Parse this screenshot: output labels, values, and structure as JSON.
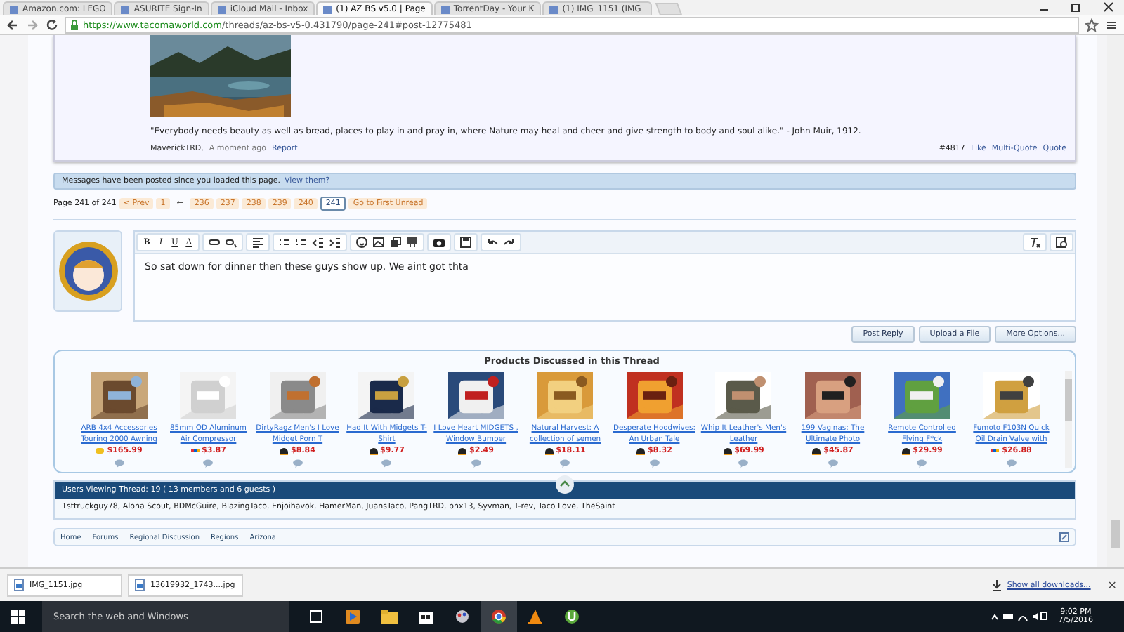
{
  "browser": {
    "tabs": [
      {
        "label": "Amazon.com: LEGO",
        "selected": false
      },
      {
        "label": "ASURITE Sign-In",
        "selected": false
      },
      {
        "label": "iCloud Mail - Inbox",
        "selected": false
      },
      {
        "label": "(1) AZ BS v5.0 | Page",
        "selected": true
      },
      {
        "label": "TorrentDay - Your K",
        "selected": false
      },
      {
        "label": "(1) IMG_1151 (IMG_",
        "selected": false
      }
    ],
    "url_host": "https://www.tacomaworld.com",
    "url_path": "/threads/az-bs-v5-0.431790/page-241#post-12775481"
  },
  "post": {
    "quote": "\"Everybody needs beauty as well as bread, places to play in and pray in, where Nature may heal and cheer and give strength to body and soul alike.\" - John Muir, 1912.",
    "author": "MaverickTRD,",
    "time": "A moment ago",
    "report": "Report",
    "number": "#4817",
    "actions": [
      "Like",
      "Multi-Quote",
      "Quote"
    ]
  },
  "notice": {
    "text": "Messages have been posted since you loaded this page.",
    "link": "View them?"
  },
  "pagination": {
    "label": "Page 241 of 241",
    "prev": "< Prev",
    "first": "1",
    "gap": "←",
    "pages": [
      {
        "label": "236",
        "selected": false
      },
      {
        "label": "237",
        "selected": false
      },
      {
        "label": "238",
        "selected": false
      },
      {
        "label": "239",
        "selected": false
      },
      {
        "label": "240",
        "selected": false
      },
      {
        "label": "241",
        "selected": true
      }
    ],
    "unread": "Go to First Unread"
  },
  "editor": {
    "value": "So sat down for dinner then these guys show up. We aint got thta",
    "format_buttons": [
      "B",
      "I",
      "U",
      "A"
    ],
    "buttons": [
      "Post Reply",
      "Upload a File",
      "More Options..."
    ]
  },
  "products": {
    "title": "Products Discussed in this Thread",
    "items": [
      {
        "title": "ARB 4x4 Accessories Touring 2000 Awning",
        "price": "$165.99",
        "kind": "other"
      },
      {
        "title": "85mm OD Aluminum Air Compressor",
        "price": "$3.87",
        "kind": "ebay"
      },
      {
        "title": "DirtyRagz Men's I Love Midget Porn T",
        "price": "$8.84",
        "kind": "amazon"
      },
      {
        "title": "Had It With Midgets T-Shirt",
        "price": "$9.77",
        "kind": "amazon"
      },
      {
        "title": "I Love Heart MIDGETS , Window Bumper",
        "price": "$2.49",
        "kind": "amazon"
      },
      {
        "title": "Natural Harvest: A collection of semen",
        "price": "$18.11",
        "kind": "amazon"
      },
      {
        "title": "Desperate Hoodwives: An Urban Tale",
        "price": "$8.32",
        "kind": "amazon"
      },
      {
        "title": "Whip It Leather's Men's Leather",
        "price": "$69.99",
        "kind": "amazon"
      },
      {
        "title": "199 Vaginas: The Ultimate Photo",
        "price": "$45.87",
        "kind": "amazon"
      },
      {
        "title": "Remote Controlled Flying F*ck",
        "price": "$29.99",
        "kind": "amazon"
      },
      {
        "title": "Fumoto F103N Quick Oil Drain Valve with",
        "price": "$26.88",
        "kind": "ebay"
      }
    ]
  },
  "viewers": {
    "title": "Users Viewing Thread: 19 ( 13 members and 6 guests )",
    "names": "1sttruckguy78, Aloha Scout, BDMcGuire, BlazingTaco, Enjoihavok, HamerMan, JuansTaco, PangTRD, phx13, Syvman, T-rev, Taco Love, TheSaint"
  },
  "breadcrumb": [
    "Home",
    "Forums",
    "Regional Discussion",
    "Regions",
    "Arizona"
  ],
  "downloads": {
    "files": [
      "IMG_1151.jpg",
      "13619932_1743....jpg"
    ],
    "show_all": "Show all downloads...",
    "close": "×"
  },
  "taskbar": {
    "search_placeholder": "Search the web and Windows",
    "time": "9:02 PM",
    "date": "7/5/2016"
  }
}
